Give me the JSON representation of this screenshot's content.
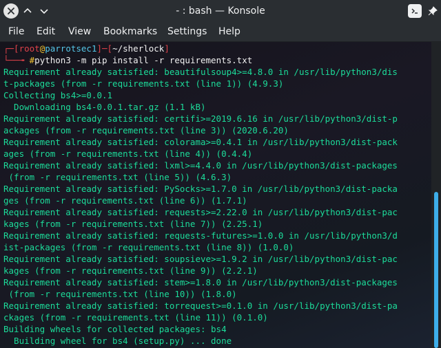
{
  "window": {
    "title": "- : bash — Konsole",
    "icons": [
      "close-icon",
      "chevron-up-icon",
      "chevron-down-icon",
      "terminal-icon",
      "pin-icon"
    ]
  },
  "menu": [
    "File",
    "Edit",
    "View",
    "Bookmarks",
    "Settings",
    "Help"
  ],
  "terminal": {
    "prompt": {
      "box_top": "┌─[",
      "user": "root",
      "at": "@",
      "host": "parrotsec1",
      "mid": "]─[",
      "path": "~/sherlock",
      "end": "]",
      "box_bottom": "└──╼ ",
      "symbol": "#",
      "command": "python3 -m pip install -r requirements.txt"
    },
    "output": [
      "Requirement already satisfied: beautifulsoup4>=4.8.0 in /usr/lib/python3/dis",
      "t-packages (from -r requirements.txt (line 1)) (4.9.3)",
      "Collecting bs4>=0.0.1",
      "  Downloading bs4-0.0.1.tar.gz (1.1 kB)",
      "Requirement already satisfied: certifi>=2019.6.16 in /usr/lib/python3/dist-p",
      "ackages (from -r requirements.txt (line 3)) (2020.6.20)",
      "Requirement already satisfied: colorama>=0.4.1 in /usr/lib/python3/dist-pack",
      "ages (from -r requirements.txt (line 4)) (0.4.4)",
      "Requirement already satisfied: lxml>=4.4.0 in /usr/lib/python3/dist-packages",
      " (from -r requirements.txt (line 5)) (4.6.3)",
      "Requirement already satisfied: PySocks>=1.7.0 in /usr/lib/python3/dist-packa",
      "ges (from -r requirements.txt (line 6)) (1.7.1)",
      "Requirement already satisfied: requests>=2.22.0 in /usr/lib/python3/dist-pac",
      "kages (from -r requirements.txt (line 7)) (2.25.1)",
      "Requirement already satisfied: requests-futures>=1.0.0 in /usr/lib/python3/d",
      "ist-packages (from -r requirements.txt (line 8)) (1.0.0)",
      "Requirement already satisfied: soupsieve>=1.9.2 in /usr/lib/python3/dist-pac",
      "kages (from -r requirements.txt (line 9)) (2.2.1)",
      "Requirement already satisfied: stem>=1.8.0 in /usr/lib/python3/dist-packages",
      " (from -r requirements.txt (line 10)) (1.8.0)",
      "Requirement already satisfied: torrequest>=0.1.0 in /usr/lib/python3/dist-pa",
      "ckages (from -r requirements.txt (line 11)) (0.1.0)",
      "Building wheels for collected packages: bs4",
      "  Building wheel for bs4 (setup.py) ... done"
    ]
  },
  "colors": {
    "output": "#1cdc9a",
    "prompt_frame": "#e0424a",
    "accent": "#3daee9"
  }
}
